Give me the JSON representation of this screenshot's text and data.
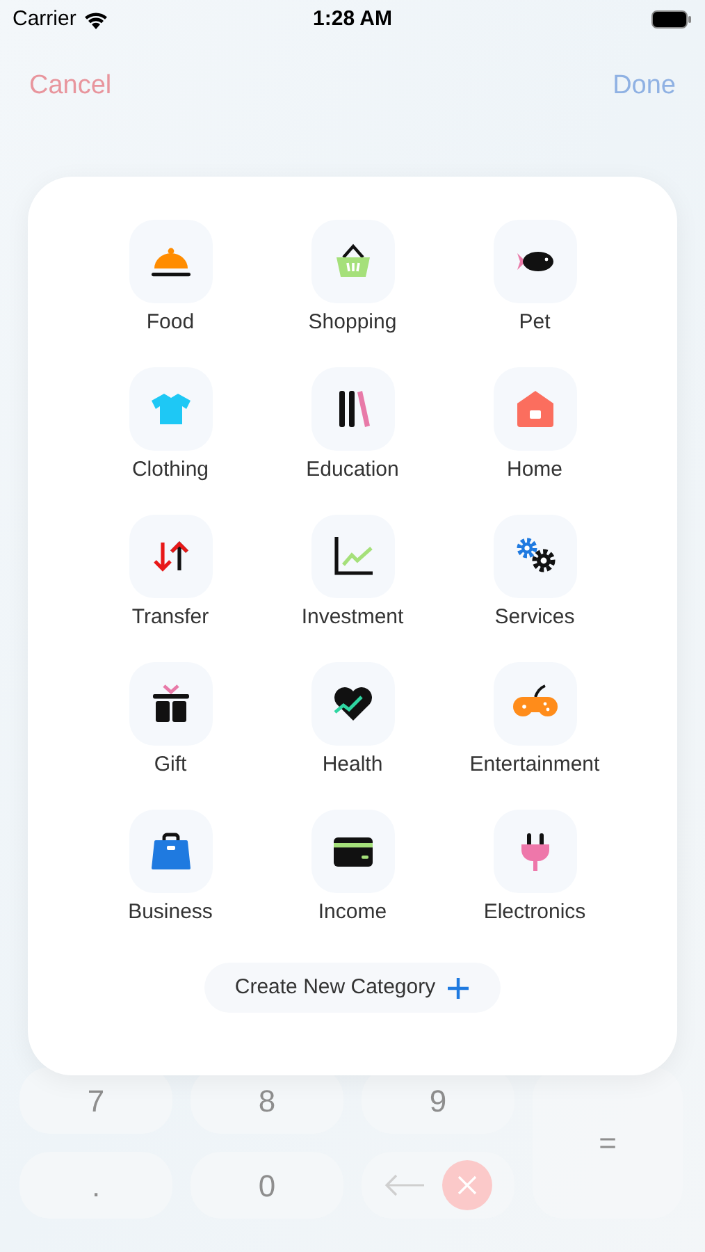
{
  "status_bar": {
    "carrier": "Carrier",
    "time": "1:28 AM"
  },
  "nav": {
    "cancel": "Cancel",
    "done": "Done"
  },
  "keypad": [
    {
      "kind": "text",
      "label": "7"
    },
    {
      "kind": "text",
      "label": "8"
    },
    {
      "kind": "text",
      "label": "9"
    },
    {
      "kind": "equals",
      "label": "="
    },
    {
      "kind": "text",
      "label": "."
    },
    {
      "kind": "text",
      "label": "0"
    },
    {
      "kind": "backspace"
    }
  ],
  "categories": [
    {
      "label": "Food",
      "kind": "cloche"
    },
    {
      "label": "Shopping",
      "kind": "basket"
    },
    {
      "label": "Pet",
      "kind": "fish"
    },
    {
      "label": "Clothing",
      "kind": "shirt"
    },
    {
      "label": "Education",
      "kind": "books"
    },
    {
      "label": "Home",
      "kind": "house"
    },
    {
      "label": "Transfer",
      "kind": "arrows"
    },
    {
      "label": "Investment",
      "kind": "chart"
    },
    {
      "label": "Services",
      "kind": "gears"
    },
    {
      "label": "Gift",
      "kind": "gift"
    },
    {
      "label": "Health",
      "kind": "heart"
    },
    {
      "label": "Entertainment",
      "kind": "gamepad"
    },
    {
      "label": "Business",
      "kind": "briefcase"
    },
    {
      "label": "Income",
      "kind": "card"
    },
    {
      "label": "Electronics",
      "kind": "plug"
    }
  ],
  "create_button": {
    "label": "Create New Category"
  }
}
